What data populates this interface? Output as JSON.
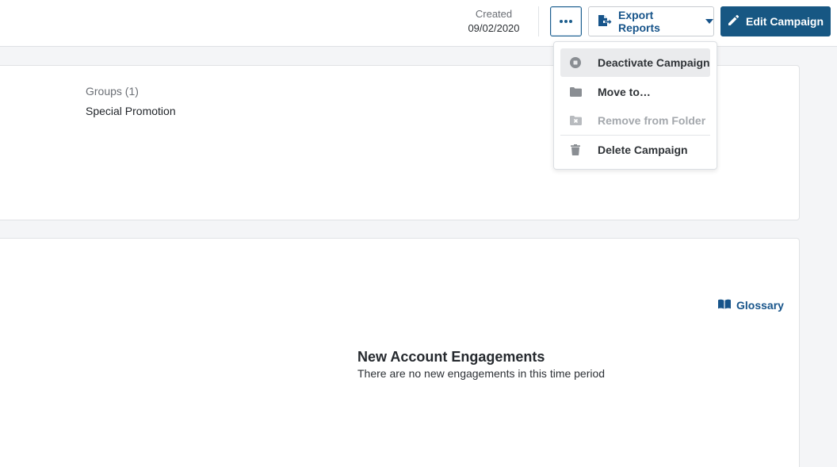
{
  "header": {
    "created_label": "Created",
    "created_date": "09/02/2020",
    "export_label": "Export Reports",
    "edit_label": "Edit Campaign"
  },
  "details": {
    "groups_label": "Groups (1)",
    "groups_value": "Special Promotion"
  },
  "engagements": {
    "glossary_label": "Glossary",
    "title": "New Account Engagements",
    "empty_message": "There are no new engagements in this time period"
  },
  "menu": {
    "items": [
      {
        "label": "Deactivate Campaign",
        "icon": "stop-circle-icon",
        "state": "hovered"
      },
      {
        "label": "Move to…",
        "icon": "folder-icon",
        "state": "enabled"
      },
      {
        "label": "Remove from Folder",
        "icon": "folder-remove-icon",
        "state": "disabled"
      },
      {
        "label": "Delete Campaign",
        "icon": "trash-icon",
        "state": "enabled"
      }
    ]
  },
  "colors": {
    "primary": "#175783",
    "link": "#17548a",
    "icon_gray": "#8a8e93",
    "disabled_text": "#a4a8ad"
  }
}
